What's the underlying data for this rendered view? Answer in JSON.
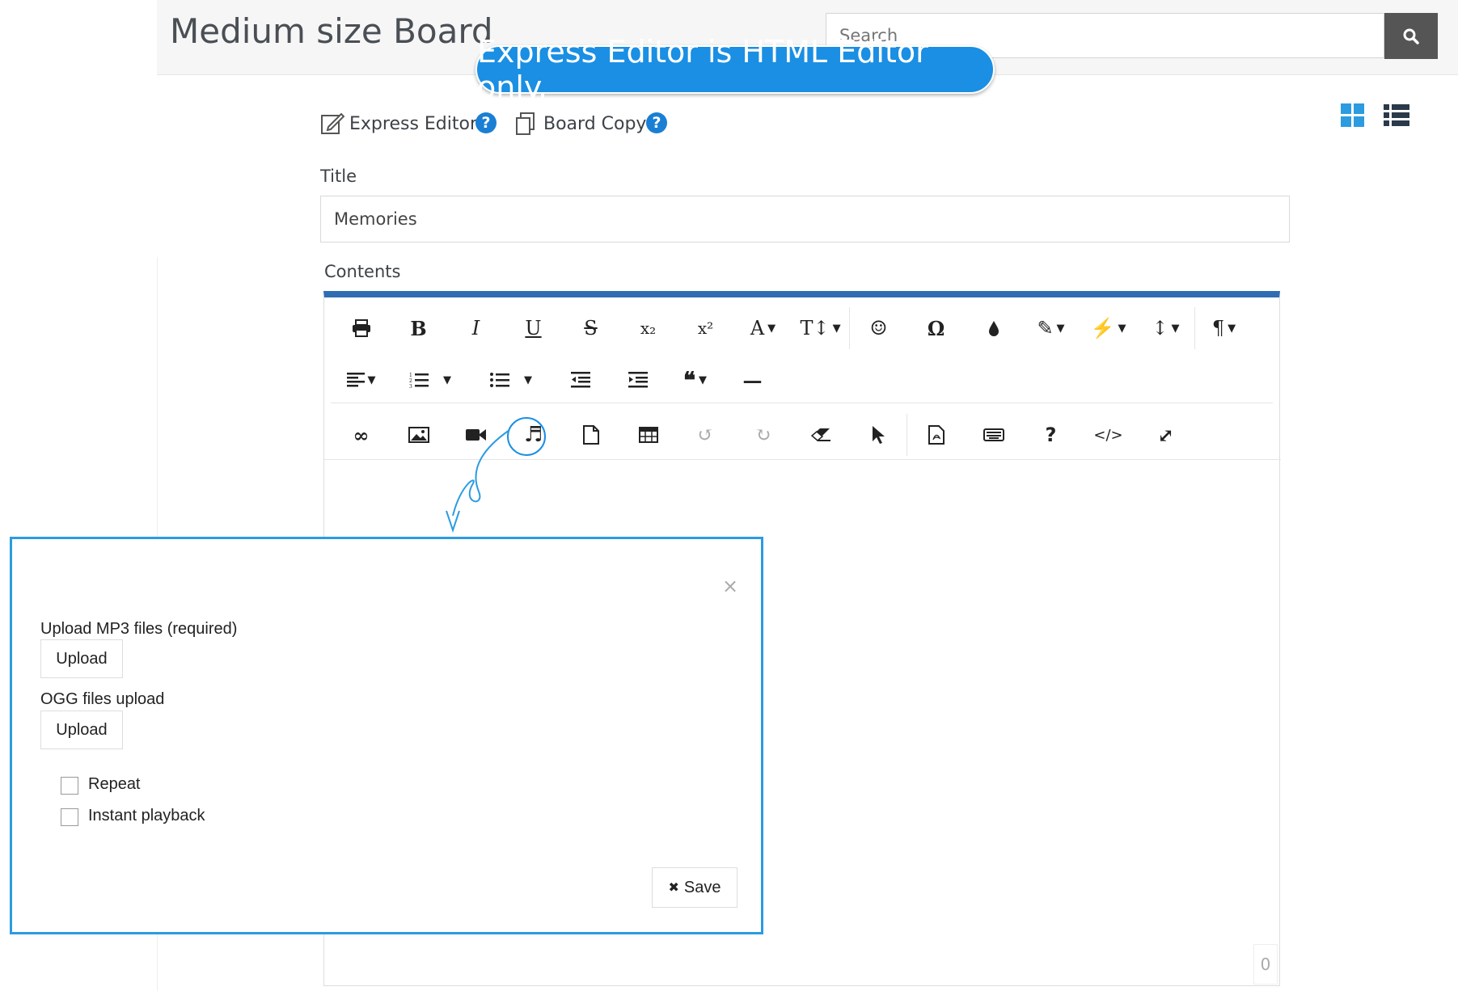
{
  "header": {
    "board_title": "Medium size Board",
    "search_placeholder": "Search"
  },
  "callout": {
    "text": "Express Editor is HTML Editor only."
  },
  "links": {
    "express_editor": "Express Editor",
    "board_copy": "Board Copy",
    "help_glyph": "?"
  },
  "form": {
    "title_label": "Title",
    "title_value": "Memories",
    "contents_label": "Contents"
  },
  "toolbar": {
    "row1": [
      "print-icon",
      "bold-icon",
      "italic-icon",
      "underline-icon",
      "strikethrough-icon",
      "subscript-icon",
      "superscript-icon",
      "font-color-icon",
      "font-size-icon",
      "emoji-icon",
      "special-char-icon",
      "highlight-icon",
      "paint-brush-icon",
      "magic-wand-icon",
      "line-height-icon",
      "paragraph-icon"
    ],
    "row2": [
      "align-icon",
      "ordered-list-icon",
      "unordered-list-icon",
      "outdent-icon",
      "indent-icon",
      "quote-icon",
      "horizontal-rule-icon"
    ],
    "row3": [
      "link-icon",
      "image-icon",
      "video-icon",
      "audio-icon",
      "file-icon",
      "table-icon",
      "undo-icon",
      "redo-icon",
      "eraser-icon",
      "select-icon",
      "pdf-icon",
      "keyboard-icon",
      "help-icon",
      "code-view-icon",
      "fullscreen-icon"
    ],
    "glyphs": {
      "bold": "B",
      "italic": "I",
      "underline": "U",
      "strike": "S",
      "sub": "x₂",
      "sup": "x²",
      "font_color": "A",
      "font_size": "T↕",
      "emoji": "☺",
      "omega": "Ω",
      "drop": "●",
      "brush": "✎",
      "wand": "⚡",
      "line_height": "↕",
      "pilcrow": "¶",
      "quote": "❝",
      "dash": "—",
      "link": "∞",
      "music": "♬",
      "undo": "↺",
      "redo": "↻",
      "cursor": "➤",
      "question": "?",
      "code": "</>",
      "expand": "⤢"
    }
  },
  "modal": {
    "close_glyph": "×",
    "mp3_label": "Upload MP3 files (required)",
    "ogg_label": "OGG files upload",
    "upload_label": "Upload",
    "repeat_label": "Repeat",
    "instant_label": "Instant playback",
    "save_icon": "✖",
    "save_label": "Save"
  },
  "editor": {
    "char_count": "0"
  },
  "colors": {
    "accent": "#1a8fe3",
    "editor_top_border": "#2f6db3",
    "help_icon": "#1a7fd4",
    "search_button": "#555555"
  }
}
